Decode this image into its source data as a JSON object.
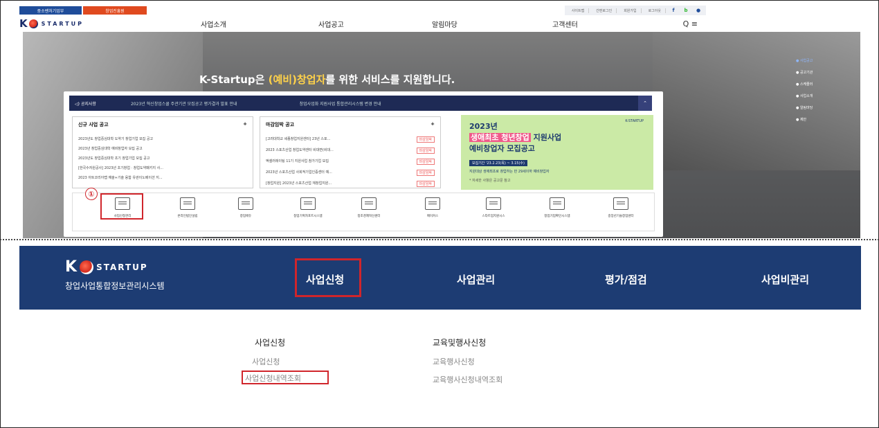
{
  "gov": {
    "badge1": "중소벤처기업부",
    "badge2": "창업진흥원"
  },
  "util_links": [
    "사이트맵",
    "간편로그인",
    "회원가입",
    "로그아웃"
  ],
  "sns": {
    "facebook": "f",
    "blog": "b",
    "other": "●"
  },
  "header": {
    "logo_word": "STARTUP",
    "nav": [
      "사업소개",
      "사업공고",
      "알림마당",
      "고객센터"
    ],
    "search_menu": "Q ≡"
  },
  "hero": {
    "title_pre": "K-Startup은 ",
    "title_highlight": "(예비)창업자",
    "title_post": "를 위한 서비스를 지원합니다.",
    "side_nav": [
      "● 사업공고",
      "● 공고기관",
      "● 스케줄러",
      "● 사업소개",
      "● 알림마당",
      "● 제안"
    ]
  },
  "notice": {
    "label": "◁) 공지사항",
    "item1": "2023년 혁신창업스쿨 주관기관 모집공고 평가결과 발표 안내",
    "item2": "창업사업화 지원사업 통합관리시스템 변경 안내",
    "button": "⌃"
  },
  "new_box": {
    "title": "신규 사업 공고",
    "more": "+",
    "items": [
      "2023년도 창업중심대학 도약기 창업기업 모집 공고",
      "2023년 창업중심대학 예비창업자 모집 공고",
      "2023년도 창업중심대학 초기 창업기업 모집 공고",
      "[한국수자원공사] 2023년 초기창업 · 창업도약패키지 사...",
      "2023 아트코리아랩 예술+기술 융합 유관이노베이션 지..."
    ]
  },
  "deadline_box": {
    "title": "마감임박 공고",
    "more": "+",
    "tag": "마감임박",
    "items": [
      "[고려대학교 세종창업지원센터] 23년 스포...",
      "2023 스포츠산업 창업도약센터 비대면(비대...",
      "액셀러레이팅 11기 지원사업 참가기업 모집",
      "2023년 스포츠산업 사회적기업인증센터 예...",
      "[창업지원] 2023년 스포츠산업 재창업지원..."
    ]
  },
  "banner": {
    "line1": "2023년",
    "line2_hl": "생애최초 청년창업",
    "line2_post": " 지원사업",
    "line3": "예비창업자 모집공고",
    "line4": "모집기간 '23.2.23(목) ~ 3.15(수)",
    "line5": "지원대상 생애최초로 창업하는 만 29세이하 예비창업자",
    "line6": "* 자세한 사항은 공고문 참고",
    "logo": "K-STARTUP"
  },
  "quick": {
    "num": "①",
    "items": [
      "사업신청관리",
      "온라인법인설립",
      "창업에듀",
      "창업기획자포트시스템",
      "창조경제혁신센터",
      "메이커스",
      "스타트업지원시스",
      "창업기업확인시스템",
      "중장년기술창업센터"
    ]
  },
  "system": {
    "logo_word": "STARTUP",
    "subtitle": "창업사업통합정보관리시스템",
    "menu": [
      "사업신청",
      "사업관리",
      "평가/점검",
      "사업비관리"
    ]
  },
  "submenu": {
    "col1_head": "사업신청",
    "col1_links": [
      "사업신청",
      "사업신청내역조회"
    ],
    "col2_head": "교육및행사신청",
    "col2_links": [
      "교육행사신청",
      "교육행사신청내역조회"
    ]
  }
}
